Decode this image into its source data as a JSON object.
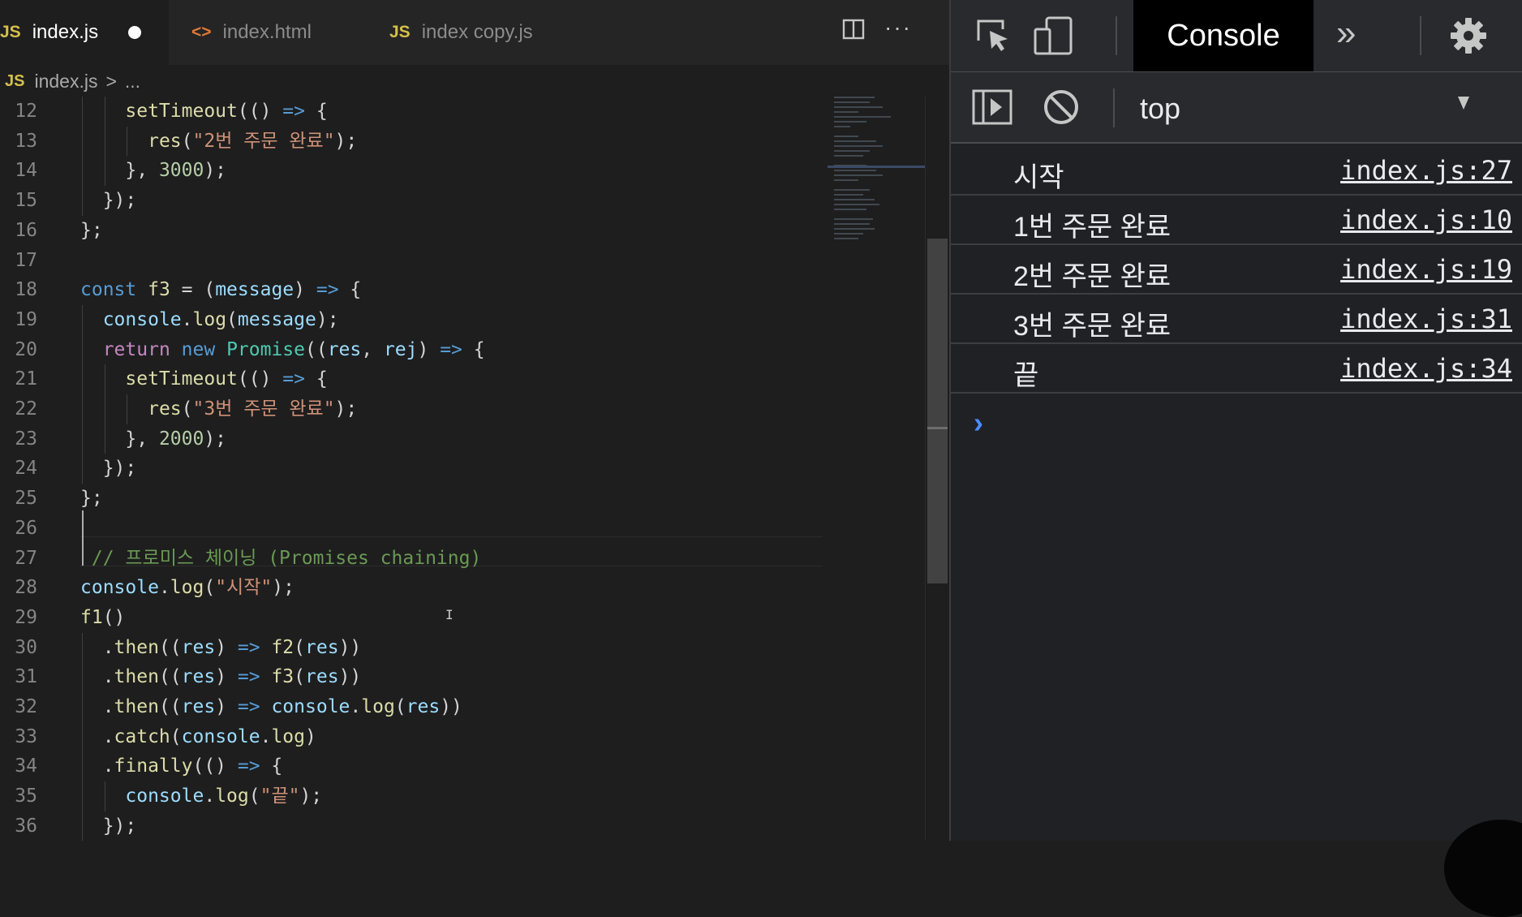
{
  "editor": {
    "tabs": [
      {
        "label": "index.js",
        "icon": "JS",
        "active": true,
        "modified": true
      },
      {
        "label": "index.html",
        "icon": "<>",
        "active": false
      },
      {
        "label": "index copy.js",
        "icon": "JS",
        "active": false
      }
    ],
    "actions": {
      "split_icon": "split-editor-icon",
      "more_icon": "more-actions-icon"
    },
    "breadcrumb": {
      "icon": "JS",
      "file": "index.js",
      "sep": ">",
      "tail": "..."
    },
    "lines": [
      {
        "n": "12",
        "segments": [
          {
            "t": "    "
          },
          {
            "t": "setTimeout",
            "c": "f"
          },
          {
            "t": "(() "
          },
          {
            "t": "=>",
            "c": "k"
          },
          {
            "t": " {"
          }
        ]
      },
      {
        "n": "13",
        "segments": [
          {
            "t": "      "
          },
          {
            "t": "res",
            "c": "f"
          },
          {
            "t": "("
          },
          {
            "t": "\"2번 주문 완료\"",
            "c": "s"
          },
          {
            "t": ");"
          }
        ]
      },
      {
        "n": "14",
        "segments": [
          {
            "t": "    }, "
          },
          {
            "t": "3000",
            "c": "n"
          },
          {
            "t": ");"
          }
        ]
      },
      {
        "n": "15",
        "segments": [
          {
            "t": "  });"
          }
        ]
      },
      {
        "n": "16",
        "segments": [
          {
            "t": "};"
          }
        ]
      },
      {
        "n": "17",
        "segments": []
      },
      {
        "n": "18",
        "segments": [
          {
            "t": "const",
            "c": "k"
          },
          {
            "t": " "
          },
          {
            "t": "f3",
            "c": "f"
          },
          {
            "t": " = ("
          },
          {
            "t": "message",
            "c": "v"
          },
          {
            "t": ") "
          },
          {
            "t": "=>",
            "c": "k"
          },
          {
            "t": " {"
          }
        ]
      },
      {
        "n": "19",
        "segments": [
          {
            "t": "  "
          },
          {
            "t": "console",
            "c": "v"
          },
          {
            "t": "."
          },
          {
            "t": "log",
            "c": "f"
          },
          {
            "t": "("
          },
          {
            "t": "message",
            "c": "v"
          },
          {
            "t": ");"
          }
        ]
      },
      {
        "n": "20",
        "segments": [
          {
            "t": "  "
          },
          {
            "t": "return",
            "c": "c"
          },
          {
            "t": " "
          },
          {
            "t": "new",
            "c": "k"
          },
          {
            "t": " "
          },
          {
            "t": "Promise",
            "c": "cls"
          },
          {
            "t": "(("
          },
          {
            "t": "res",
            "c": "v"
          },
          {
            "t": ", "
          },
          {
            "t": "rej",
            "c": "v"
          },
          {
            "t": ") "
          },
          {
            "t": "=>",
            "c": "k"
          },
          {
            "t": " {"
          }
        ]
      },
      {
        "n": "21",
        "segments": [
          {
            "t": "    "
          },
          {
            "t": "setTimeout",
            "c": "f"
          },
          {
            "t": "(() "
          },
          {
            "t": "=>",
            "c": "k"
          },
          {
            "t": " {"
          }
        ]
      },
      {
        "n": "22",
        "segments": [
          {
            "t": "      "
          },
          {
            "t": "res",
            "c": "f"
          },
          {
            "t": "("
          },
          {
            "t": "\"3번 주문 완료\"",
            "c": "s"
          },
          {
            "t": ");"
          }
        ]
      },
      {
        "n": "23",
        "segments": [
          {
            "t": "    }, "
          },
          {
            "t": "2000",
            "c": "n"
          },
          {
            "t": ");"
          }
        ]
      },
      {
        "n": "24",
        "segments": [
          {
            "t": "  });"
          }
        ]
      },
      {
        "n": "25",
        "segments": [
          {
            "t": "};"
          }
        ]
      },
      {
        "n": "26",
        "segments": []
      },
      {
        "n": "27",
        "segments": [
          {
            "t": " // 프로미스 체이닝 (Promises chaining)",
            "c": "cm"
          }
        ]
      },
      {
        "n": "28",
        "segments": [
          {
            "t": "console",
            "c": "v"
          },
          {
            "t": "."
          },
          {
            "t": "log",
            "c": "f"
          },
          {
            "t": "("
          },
          {
            "t": "\"시작\"",
            "c": "s"
          },
          {
            "t": ");"
          }
        ]
      },
      {
        "n": "29",
        "segments": [
          {
            "t": "f1",
            "c": "f"
          },
          {
            "t": "()"
          }
        ]
      },
      {
        "n": "30",
        "segments": [
          {
            "t": "  ."
          },
          {
            "t": "then",
            "c": "f"
          },
          {
            "t": "(("
          },
          {
            "t": "res",
            "c": "v"
          },
          {
            "t": ") "
          },
          {
            "t": "=>",
            "c": "k"
          },
          {
            "t": " "
          },
          {
            "t": "f2",
            "c": "f"
          },
          {
            "t": "("
          },
          {
            "t": "res",
            "c": "v"
          },
          {
            "t": "))"
          }
        ]
      },
      {
        "n": "31",
        "segments": [
          {
            "t": "  ."
          },
          {
            "t": "then",
            "c": "f"
          },
          {
            "t": "(("
          },
          {
            "t": "res",
            "c": "v"
          },
          {
            "t": ") "
          },
          {
            "t": "=>",
            "c": "k"
          },
          {
            "t": " "
          },
          {
            "t": "f3",
            "c": "f"
          },
          {
            "t": "("
          },
          {
            "t": "res",
            "c": "v"
          },
          {
            "t": "))"
          }
        ]
      },
      {
        "n": "32",
        "segments": [
          {
            "t": "  ."
          },
          {
            "t": "then",
            "c": "f"
          },
          {
            "t": "(("
          },
          {
            "t": "res",
            "c": "v"
          },
          {
            "t": ") "
          },
          {
            "t": "=>",
            "c": "k"
          },
          {
            "t": " "
          },
          {
            "t": "console",
            "c": "v"
          },
          {
            "t": "."
          },
          {
            "t": "log",
            "c": "f"
          },
          {
            "t": "("
          },
          {
            "t": "res",
            "c": "v"
          },
          {
            "t": "))"
          }
        ]
      },
      {
        "n": "33",
        "segments": [
          {
            "t": "  ."
          },
          {
            "t": "catch",
            "c": "f"
          },
          {
            "t": "("
          },
          {
            "t": "console",
            "c": "v"
          },
          {
            "t": "."
          },
          {
            "t": "log",
            "c": "f"
          },
          {
            "t": ")"
          }
        ]
      },
      {
        "n": "34",
        "segments": [
          {
            "t": "  ."
          },
          {
            "t": "finally",
            "c": "f"
          },
          {
            "t": "(() "
          },
          {
            "t": "=>",
            "c": "k"
          },
          {
            "t": " {"
          }
        ]
      },
      {
        "n": "35",
        "segments": [
          {
            "t": "    "
          },
          {
            "t": "console",
            "c": "v"
          },
          {
            "t": "."
          },
          {
            "t": "log",
            "c": "f"
          },
          {
            "t": "("
          },
          {
            "t": "\"끝\"",
            "c": "s"
          },
          {
            "t": ");"
          }
        ]
      },
      {
        "n": "36",
        "segments": [
          {
            "t": "  });"
          }
        ]
      }
    ]
  },
  "devtools": {
    "toolbar": {
      "inspect_icon": "inspect-element-icon",
      "device_icon": "device-toolbar-icon",
      "active_tab": "Console",
      "more_tabs": "»",
      "settings_icon": "gear-icon"
    },
    "context": {
      "value": "top",
      "sidebar_icon": "console-sidebar-icon",
      "clear_icon": "clear-console-icon"
    },
    "logs": [
      {
        "message": "시작",
        "source": "index.js:27"
      },
      {
        "message": "1번 주문 완료",
        "source": "index.js:10"
      },
      {
        "message": "2번 주문 완료",
        "source": "index.js:19"
      },
      {
        "message": "3번 주문 완료",
        "source": "index.js:31"
      },
      {
        "message": "끝",
        "source": "index.js:34"
      }
    ],
    "prompt": "›"
  },
  "colors": {
    "editor_bg": "#1e1e1e",
    "keyword": "#569cd6",
    "control": "#c586c0",
    "function": "#dcdcaa",
    "variable": "#9cdcfe",
    "string": "#ce9178",
    "number": "#b5cea8",
    "class": "#4ec9b0",
    "comment": "#6a9955",
    "devtools_bg": "#202124",
    "prompt_blue": "#4a8cff"
  }
}
